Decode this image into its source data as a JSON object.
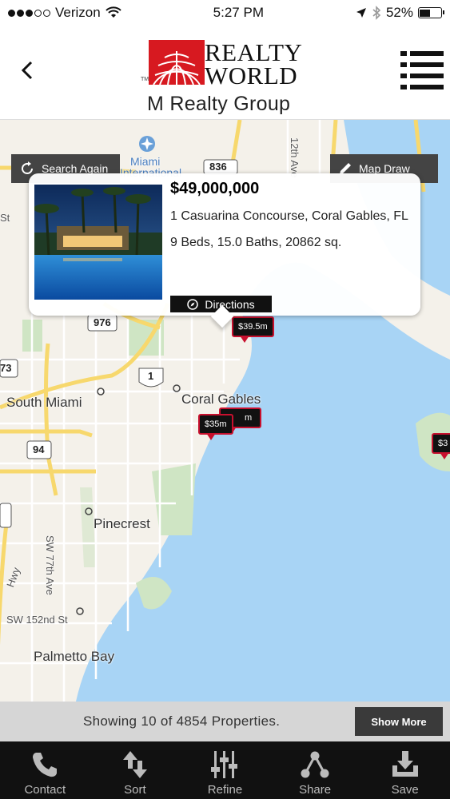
{
  "status_bar": {
    "carrier": "Verizon",
    "time": "5:27 PM",
    "battery": "52%",
    "battery_level": 0.52,
    "icons": [
      "signal-dots",
      "wifi-icon",
      "location-arrow-icon",
      "bluetooth-icon",
      "battery-icon"
    ]
  },
  "header": {
    "logo_word1": "REALTY",
    "logo_word2": "WORLD",
    "logo_tm": "TM",
    "logo_sub": "M Realty Group",
    "back_icon": "chevron-left-icon",
    "menu_icon": "list-menu-icon"
  },
  "map": {
    "search_again_label": "Search Again",
    "map_draw_label": "Map Draw",
    "places": {
      "south_miami": "South Miami",
      "coral_gables": "Coral Gables",
      "pinecrest": "Pinecrest",
      "palmetto_bay": "Palmetto Bay",
      "miami_intl_1": "Miami",
      "miami_intl_2": "International"
    },
    "streets": {
      "ave12": "12th Ave",
      "sw77": "SW 77th Ave",
      "sw152": "SW 152nd St",
      "hwy": "Hwy",
      "st": "St"
    },
    "shields": {
      "r976": "976",
      "r73": "73",
      "r1": "1",
      "r94": "94",
      "r836": "836"
    },
    "pins": {
      "p1": "$39.5m",
      "p2": "$35m",
      "p3": "m",
      "p4": "$3"
    },
    "colors": {
      "water": "#a8d4f5",
      "land": "#f4f1ea",
      "park": "#cfe5c4",
      "highway": "#f7d86d",
      "pin_border": "#c8102e"
    }
  },
  "callout": {
    "price": "$49,000,000",
    "address": "1 Casuarina Concourse, Coral Gables, FL",
    "details": "9 Beds, 15.0 Baths, 20862 sq.",
    "directions_label": "Directions"
  },
  "info_bar": {
    "showing_text": "Showing 10 of 4854 Properties.",
    "show_more_label": "Show More"
  },
  "tabs": [
    {
      "label": "Contact",
      "icon": "phone-icon"
    },
    {
      "label": "Sort",
      "icon": "sort-arrows-icon"
    },
    {
      "label": "Refine",
      "icon": "sliders-icon"
    },
    {
      "label": "Share",
      "icon": "share-icon"
    },
    {
      "label": "Save",
      "icon": "download-icon"
    }
  ]
}
